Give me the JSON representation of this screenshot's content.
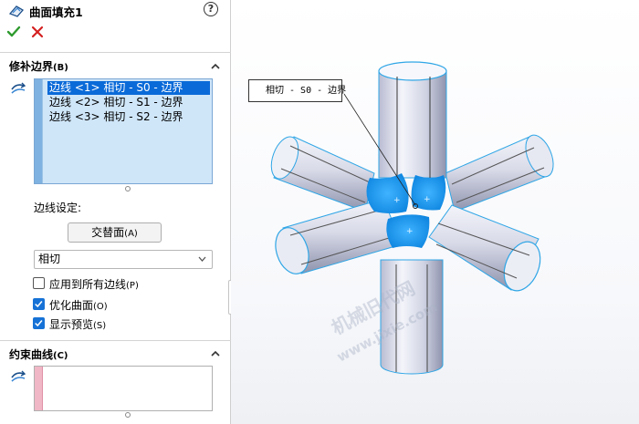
{
  "panel": {
    "title": "曲面填充1",
    "help_glyph": "?",
    "ok_icon": "check-icon",
    "cancel_icon": "close-icon",
    "patch_boundary": {
      "title": "修补边界",
      "title_key": "(B)",
      "items": [
        "边线 <1> 相切 - S0 - 边界",
        "边线 <2> 相切 - S1 - 边界",
        "边线 <3> 相切 - S2 - 边界"
      ],
      "selected_index": 0
    },
    "edge_settings": {
      "label": "边线设定:",
      "alternate_face_button": "交替面",
      "alternate_face_key": "(A)",
      "condition_value": "相切",
      "apply_all_label": "应用到所有边线",
      "apply_all_key": "(P)",
      "apply_all_checked": false,
      "optimize_label": "优化曲面",
      "optimize_key": "(O)",
      "optimize_checked": true,
      "preview_label": "显示预览",
      "preview_key": "(S)",
      "preview_checked": true
    },
    "constraint_curves": {
      "title": "约束曲线",
      "title_key": "(C)"
    }
  },
  "viewport": {
    "callout_text": "相切 - S0 - 边界",
    "watermark_cn": "机械旧代网",
    "watermark_url": "www.jixie.com",
    "accent": "#1aa3f0",
    "tube_edge": "#2fa6e6"
  }
}
